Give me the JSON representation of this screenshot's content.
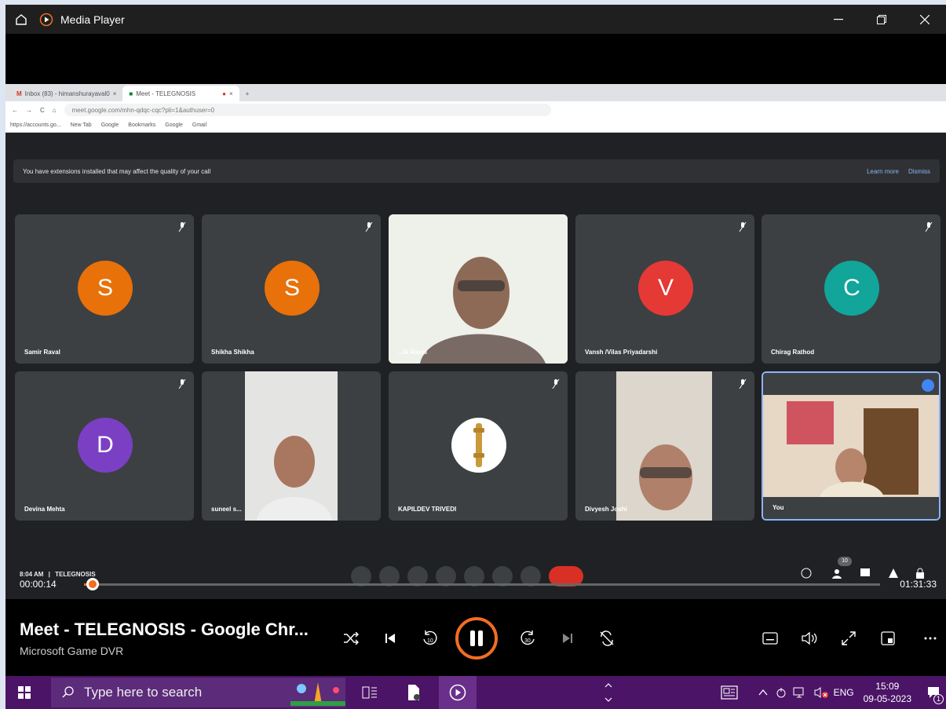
{
  "window": {
    "title": "Media Player"
  },
  "browser": {
    "tabs": [
      "Inbox (83) - himanshurayaval0",
      "Meet - TELEGNOSIS"
    ],
    "url": "meet.google.com/mhn-qdqc-cqc?pli=1&authuser=0",
    "bookmarks": [
      "https://accounts.go...",
      "New Tab",
      "Google",
      "Bookmarks",
      "Google",
      "Gmail"
    ]
  },
  "meet": {
    "banner": "You have extensions installed that may affect the quality of your call",
    "learn_more": "Learn more",
    "dismiss": "Dismiss",
    "participants": [
      {
        "name": "Samir Raval",
        "initial": "S",
        "color": "#e8710a"
      },
      {
        "name": "Shikha Shikha",
        "initial": "S",
        "color": "#e8710a"
      },
      {
        "name": "...ik Raval",
        "initial": "",
        "color": ""
      },
      {
        "name": "Vansh /Vilas Priyadarshi",
        "initial": "V",
        "color": "#e53935"
      },
      {
        "name": "Chirag Rathod",
        "initial": "C",
        "color": "#12a59a"
      },
      {
        "name": "Devina Mehta",
        "initial": "D",
        "color": "#7b3fc4"
      },
      {
        "name": "suneel s...",
        "initial": "",
        "color": ""
      },
      {
        "name": "KAPILDEV TRIVEDI",
        "initial": "",
        "color": ""
      },
      {
        "name": "Divyesh Joshi",
        "initial": "",
        "color": ""
      },
      {
        "name": "You",
        "initial": "",
        "color": ""
      }
    ],
    "meeting_time": "8:04 AM",
    "meeting_name": "TELEGNOSIS",
    "people_count": "10"
  },
  "player": {
    "current_time": "00:00:14",
    "total_time": "01:31:33",
    "progress": 0.0025,
    "title": "Meet - TELEGNOSIS - Google Chr...",
    "subtitle": "Microsoft Game DVR",
    "accent": "#f26d21"
  },
  "taskbar": {
    "search_placeholder": "Type here to search",
    "language": "ENG",
    "time": "15:09",
    "date": "09-05-2023",
    "notifications": "1"
  }
}
